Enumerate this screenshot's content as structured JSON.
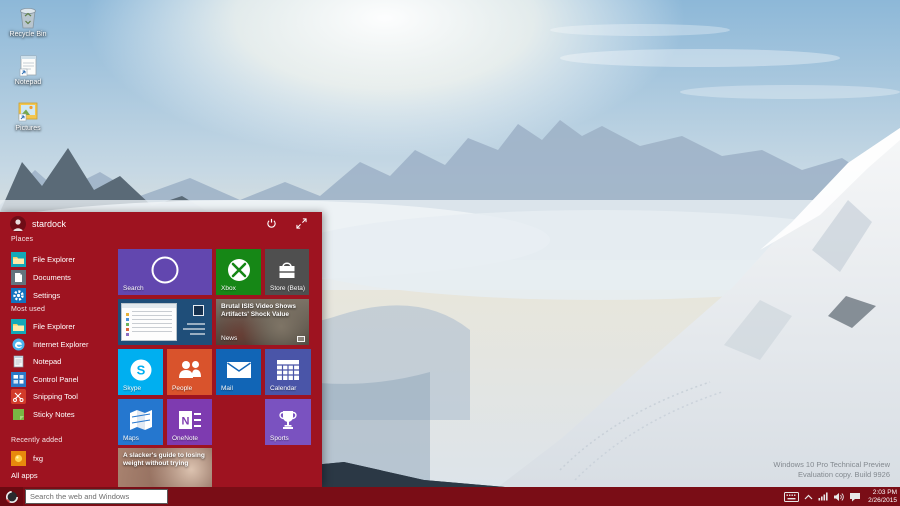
{
  "colors": {
    "menu_red": "#9e1320",
    "taskbar_red": "#7a0d16",
    "tile_search": "#6247af",
    "tile_xbox": "#168716",
    "tile_store": "#4f4f4f",
    "tile_skype": "#00aff0",
    "tile_people": "#d9532c",
    "tile_mail": "#1165b6",
    "tile_calendar": "#4a55a8",
    "tile_maps": "#2577cf",
    "tile_onenote": "#7e3bb0",
    "tile_sports": "#7a52c0",
    "tile_preview_bg": "#1f4e79"
  },
  "desktop": {
    "icons": [
      {
        "label": "Recycle Bin"
      },
      {
        "label": "Notepad"
      },
      {
        "label": "Pictures"
      }
    ],
    "watermark": {
      "line1": "Windows 10 Pro Technical Preview",
      "line2": "Evaluation copy. Build 9926"
    }
  },
  "start_menu": {
    "user_name": "stardock",
    "places": {
      "label": "Places",
      "items": [
        {
          "label": "File Explorer"
        },
        {
          "label": "Documents"
        },
        {
          "label": "Settings"
        }
      ]
    },
    "most_used": {
      "label": "Most used",
      "items": [
        {
          "label": "File Explorer"
        },
        {
          "label": "Internet Explorer"
        },
        {
          "label": "Notepad"
        },
        {
          "label": "Control Panel"
        },
        {
          "label": "Snipping Tool"
        },
        {
          "label": "Sticky Notes"
        }
      ]
    },
    "recently_added": {
      "label": "Recently added",
      "items": [
        {
          "label": "fxg"
        }
      ]
    },
    "all_apps_label": "All apps",
    "tiles": {
      "search": {
        "label": "Search"
      },
      "xbox": {
        "label": "Xbox"
      },
      "store": {
        "label": "Store (Beta)"
      },
      "news": {
        "label": "News",
        "headline": "Brutal ISIS Video Shows Artifacts' Shock Value"
      },
      "skype": {
        "label": "Skype"
      },
      "people": {
        "label": "People"
      },
      "mail": {
        "label": "Mail"
      },
      "calendar": {
        "label": "Calendar"
      },
      "maps": {
        "label": "Maps"
      },
      "onenote": {
        "label": "OneNote"
      },
      "sports": {
        "label": "Sports"
      },
      "health": {
        "headline": "A slacker's guide to losing weight without trying"
      }
    }
  },
  "taskbar": {
    "search_placeholder": "Search the web and Windows",
    "clock": {
      "time": "2:03 PM",
      "date": "2/26/2015"
    }
  }
}
